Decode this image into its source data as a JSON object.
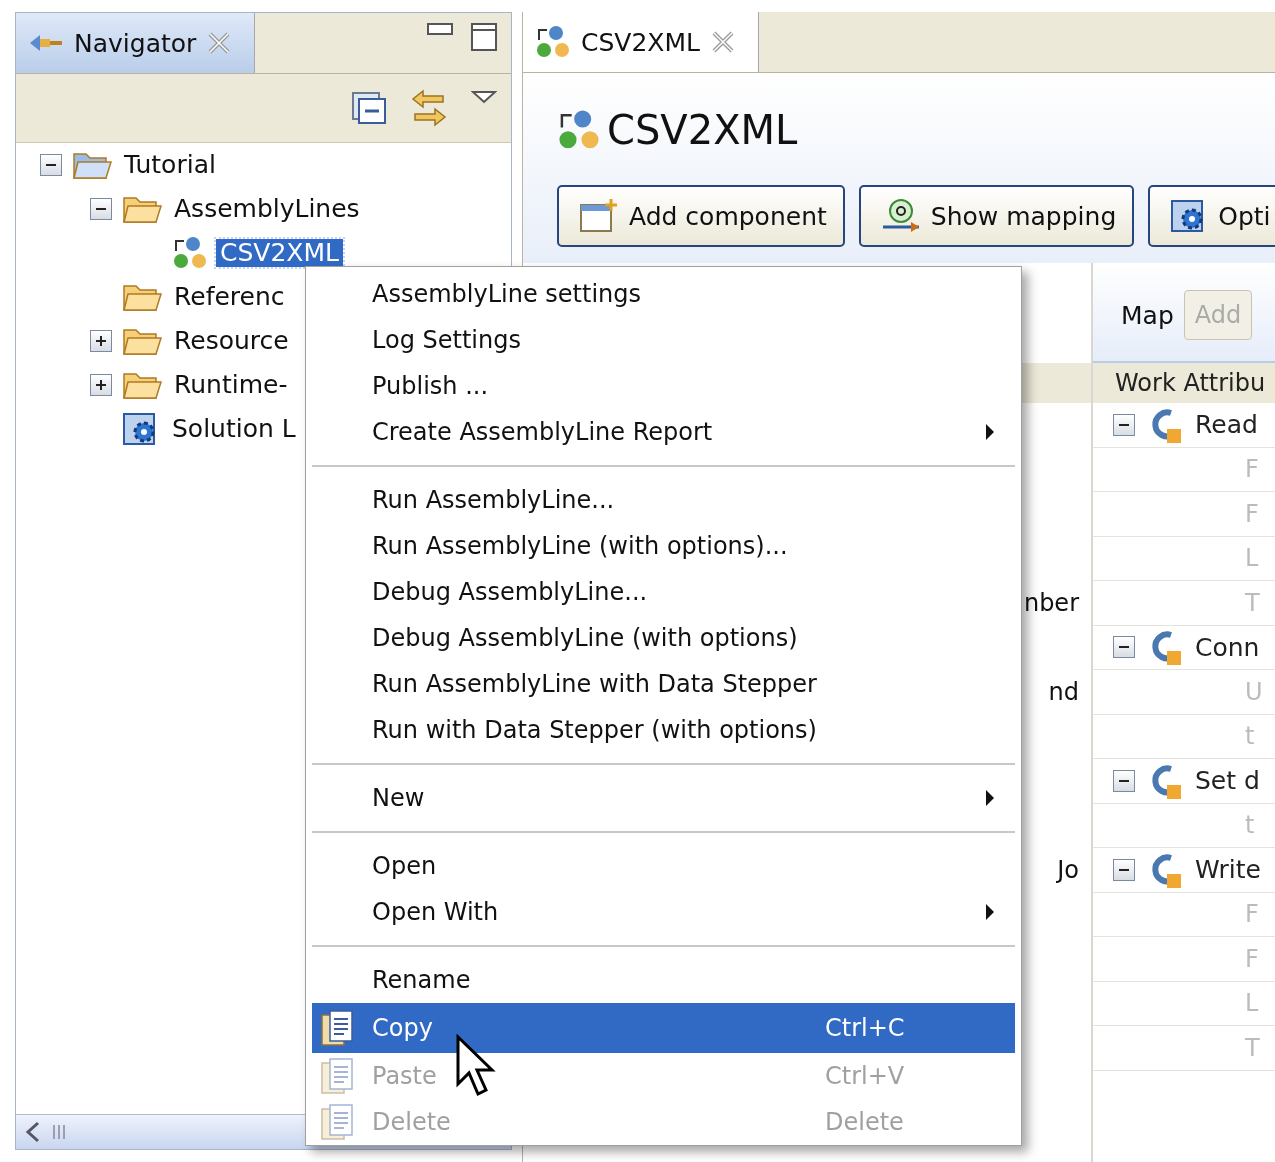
{
  "navigator": {
    "tab": {
      "label": "Navigator",
      "selected": true
    },
    "tree": [
      {
        "label": "Tutorial",
        "kind": "project",
        "expanded": true,
        "selected": false,
        "children": [
          {
            "label": "AssemblyLines",
            "kind": "folder",
            "expanded": true,
            "selected": false,
            "children": [
              {
                "label": "CSV2XML",
                "kind": "assemblyline",
                "selected": true
              }
            ]
          },
          {
            "label": "Referenc",
            "kind": "folder",
            "selected": false
          },
          {
            "label": "Resource",
            "kind": "folder",
            "expanded": false,
            "selected": false
          },
          {
            "label": "Runtime-",
            "kind": "folder",
            "expanded": false,
            "selected": false
          },
          {
            "label": "Solution L",
            "kind": "config",
            "selected": false
          }
        ]
      }
    ]
  },
  "editor": {
    "tab": {
      "label": "CSV2XML",
      "selected": true
    },
    "title": "CSV2XML",
    "buttons": [
      "Add component",
      "Show mapping",
      "Opti"
    ],
    "map_label": "Map",
    "add_button": {
      "label": "Add",
      "disabled": true
    },
    "grid_header": "Work Attribu",
    "groups": [
      {
        "label": "Read",
        "expanded": true,
        "rows": [
          {
            "column_2": "F"
          },
          {
            "column_2": "F"
          },
          {
            "column_2": "L"
          },
          {
            "column_1": "nber",
            "column_2": "T"
          }
        ]
      },
      {
        "label": "Conn",
        "expanded": true,
        "rows": [
          {
            "column_1": "nd",
            "column_2": "U"
          },
          {
            "column_2": "t"
          }
        ]
      },
      {
        "label": "Set d",
        "expanded": true,
        "rows": [
          {
            "column_2": "t"
          }
        ]
      },
      {
        "label": "Write",
        "column_1": "Jo",
        "expanded": true,
        "rows": [
          {
            "column_2": "F"
          },
          {
            "column_2": "F"
          },
          {
            "column_2": "L"
          },
          {
            "column_2": "T"
          }
        ]
      }
    ]
  },
  "context_menu": [
    {
      "kind": "item",
      "label": "AssemblyLine settings",
      "submenu": false,
      "disabled": false,
      "selected": false
    },
    {
      "kind": "item",
      "label": "Log Settings",
      "submenu": false,
      "disabled": false,
      "selected": false
    },
    {
      "kind": "item",
      "label": "Publish ...",
      "submenu": false,
      "disabled": false,
      "selected": false
    },
    {
      "kind": "item",
      "label": "Create AssemblyLine Report",
      "submenu": true,
      "disabled": false,
      "selected": false
    },
    {
      "kind": "separator"
    },
    {
      "kind": "item",
      "label": "Run AssemblyLine...",
      "submenu": false,
      "disabled": false,
      "selected": false
    },
    {
      "kind": "item",
      "label": "Run AssemblyLine (with options)...",
      "submenu": false,
      "disabled": false,
      "selected": false
    },
    {
      "kind": "item",
      "label": "Debug AssemblyLine...",
      "submenu": false,
      "disabled": false,
      "selected": false
    },
    {
      "kind": "item",
      "label": "Debug AssemblyLine (with options)",
      "submenu": false,
      "disabled": false,
      "selected": false
    },
    {
      "kind": "item",
      "label": "Run AssemblyLine with Data Stepper",
      "submenu": false,
      "disabled": false,
      "selected": false
    },
    {
      "kind": "item",
      "label": "Run with Data Stepper (with options)",
      "submenu": false,
      "disabled": false,
      "selected": false
    },
    {
      "kind": "separator"
    },
    {
      "kind": "item",
      "label": "New",
      "submenu": true,
      "disabled": false,
      "selected": false
    },
    {
      "kind": "separator"
    },
    {
      "kind": "item",
      "label": "Open",
      "submenu": false,
      "disabled": false,
      "selected": false
    },
    {
      "kind": "item",
      "label": "Open With",
      "submenu": true,
      "disabled": false,
      "selected": false
    },
    {
      "kind": "separator"
    },
    {
      "kind": "item",
      "label": "Rename",
      "submenu": false,
      "disabled": false,
      "selected": false
    },
    {
      "kind": "clipboard",
      "label": "Copy",
      "shortcut": "Ctrl+C",
      "submenu": false,
      "disabled": false,
      "selected": true
    },
    {
      "kind": "clipboard",
      "label": "Paste",
      "shortcut": "Ctrl+V",
      "submenu": false,
      "disabled": true,
      "selected": false
    },
    {
      "kind": "clipboard",
      "label": "Delete",
      "shortcut": "Delete",
      "submenu": false,
      "disabled": true,
      "selected": false
    }
  ]
}
